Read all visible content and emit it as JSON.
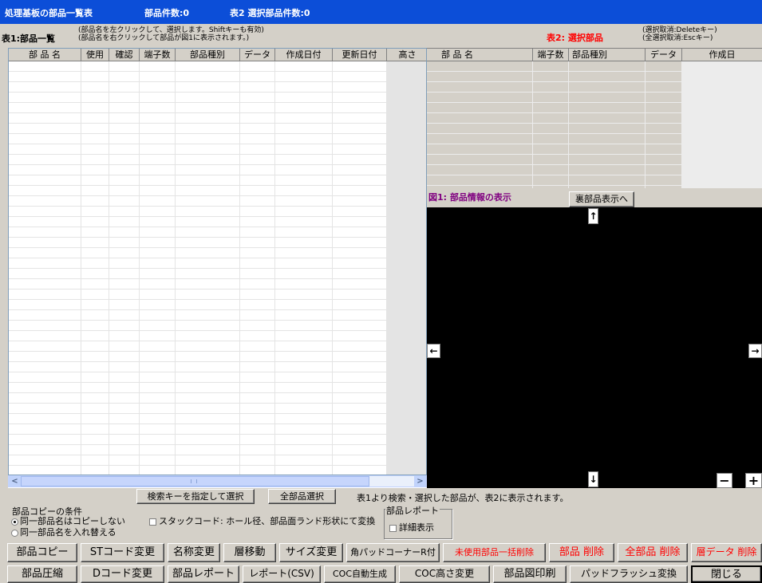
{
  "titlebar": {
    "title": "処理基板の部品一覧表",
    "part_count": "部品件数:0",
    "selected_count": "表2 選択部品件数:0"
  },
  "table1": {
    "label": "表1:部品一覧",
    "hint1": "(部品名を左クリックして、選択します。Shiftキーも有効)",
    "hint2": "(部品名を右クリックして部品が図1に表示されます。)",
    "columns": [
      "部 品 名",
      "使用",
      "確認",
      "端子数",
      "部品種別",
      "データ",
      "作成日付",
      "更新日付",
      "高さ"
    ]
  },
  "table2": {
    "label": "表2: 選択部品",
    "hint1": "(選択取消:Deleteキー)",
    "hint2": "(全選択取消:Escキー)",
    "columns": [
      "部 品 名",
      "端子数",
      "部品種別",
      "データ",
      "作成日"
    ]
  },
  "figure": {
    "label": "図1: 部品情報の表示",
    "back_button": "裏部品表示へ",
    "up": "↑",
    "down": "↓",
    "left": "←",
    "right": "→",
    "zoom_out": "−",
    "zoom_in": "+"
  },
  "search": {
    "select_by_key": "検索キーを指定して選択",
    "select_all": "全部品選択",
    "info": "表1より検索・選択した部品が、表2に表示されます。"
  },
  "copy_conditions": {
    "legend": "部品コピーの条件",
    "option1": "同一部品名はコピーしない",
    "option2": "同一部品名を入れ替える",
    "stack_code": "スタックコード: ホール径、部品面ランド形状にて変換"
  },
  "report": {
    "legend": "部品レポート",
    "detail": "詳細表示"
  },
  "buttons_row1": [
    {
      "label": "部品コピー",
      "color": "#000000"
    },
    {
      "label": "STコード変更",
      "color": "#000000"
    },
    {
      "label": "名称変更",
      "color": "#000000"
    },
    {
      "label": "層移動",
      "color": "#000000"
    },
    {
      "label": "サイズ変更",
      "color": "#000000"
    },
    {
      "label": "角パッドコーナーR付",
      "color": "#000000"
    },
    {
      "label": "未使用部品一括削除",
      "color": "#ff0000"
    },
    {
      "label": "部品 削除",
      "color": "#ff0000"
    },
    {
      "label": "全部品 削除",
      "color": "#ff0000"
    },
    {
      "label": "層データ 削除",
      "color": "#ff0000"
    }
  ],
  "buttons_row2": [
    {
      "label": "部品圧縮"
    },
    {
      "label": "Dコード変更"
    },
    {
      "label": "部品レポート"
    },
    {
      "label": "レポート(CSV)"
    },
    {
      "label": "COC自動生成"
    },
    {
      "label": "COC高さ変更"
    },
    {
      "label": "部品図印刷"
    },
    {
      "label": "パッドフラッシュ変換"
    },
    {
      "label": "閉じる"
    }
  ]
}
